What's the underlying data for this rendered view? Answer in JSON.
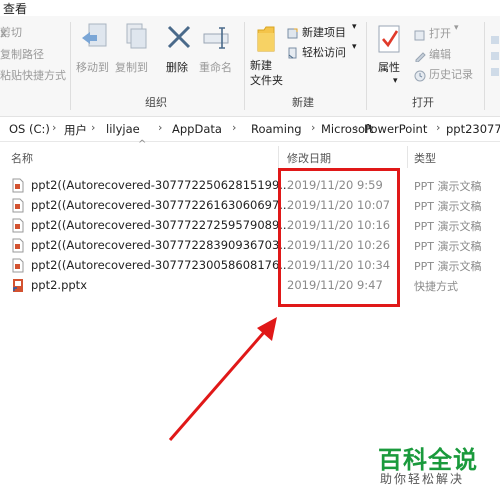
{
  "ribbon": {
    "tab_view": "查看",
    "clipboard": {
      "cut": "剪切",
      "copy_path": "复制路径",
      "paste_shortcut": "粘贴快捷方式"
    },
    "organize": {
      "move_to": "移动到",
      "copy_to": "复制到",
      "delete": "删除",
      "rename": "重命名",
      "group_label": "组织"
    },
    "new": {
      "new_item": "新建项目",
      "easy_access": "轻松访问",
      "new_folder": "新建\n文件夹",
      "group_label": "新建"
    },
    "open": {
      "properties": "属性",
      "open": "打开",
      "edit": "编辑",
      "history": "历史记录",
      "group_label": "打开"
    }
  },
  "address": {
    "crumbs": [
      "OS (C:)",
      "用户",
      "lilyjae",
      "AppData",
      "Roaming",
      "Microsoft",
      "PowerPoint",
      "ppt23077"
    ]
  },
  "columns": {
    "name": "名称",
    "date": "修改日期",
    "type": "类型"
  },
  "files": [
    {
      "name": "ppt2((Autorecovered-30777225062815199...",
      "date": "2019/11/20 9:59",
      "type": "PPT 演示文稿",
      "icon": "pptx-autorecover-icon"
    },
    {
      "name": "ppt2((Autorecovered-30777226163060697...",
      "date": "2019/11/20 10:07",
      "type": "PPT 演示文稿",
      "icon": "pptx-autorecover-icon"
    },
    {
      "name": "ppt2((Autorecovered-30777227259579089...",
      "date": "2019/11/20 10:16",
      "type": "PPT 演示文稿",
      "icon": "pptx-autorecover-icon"
    },
    {
      "name": "ppt2((Autorecovered-30777228390936703...",
      "date": "2019/11/20 10:26",
      "type": "PPT 演示文稿",
      "icon": "pptx-autorecover-icon"
    },
    {
      "name": "ppt2((Autorecovered-30777230058608176...",
      "date": "2019/11/20 10:34",
      "type": "PPT 演示文稿",
      "icon": "pptx-autorecover-icon"
    },
    {
      "name": "ppt2.pptx",
      "date": "2019/11/20 9:47",
      "type": "快捷方式",
      "icon": "shortcut-icon"
    }
  ],
  "annotation": {
    "color": "#e01818"
  },
  "watermark": {
    "title": "百科全说",
    "subtitle": "助你轻松解决",
    "color": "#1a9a3c"
  }
}
